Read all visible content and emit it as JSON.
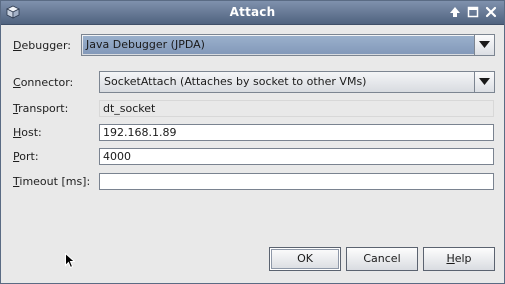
{
  "window": {
    "title": "Attach"
  },
  "form": {
    "debugger": {
      "label": "Debugger:",
      "mnemonic": "D",
      "rest": "ebugger:",
      "value": "Java Debugger (JPDA)"
    },
    "connector": {
      "label": "Connector:",
      "mnemonic": "C",
      "rest": "onnector:",
      "value": "SocketAttach (Attaches by socket to other VMs)"
    },
    "transport": {
      "label": "Transport:",
      "mnemonic": "T",
      "rest": "ransport:",
      "value": "dt_socket"
    },
    "host": {
      "label": "Host:",
      "mnemonic": "H",
      "rest": "ost:",
      "value": "192.168.1.89"
    },
    "port": {
      "label": "Port:",
      "mnemonic": "P",
      "rest": "ort:",
      "value": "4000"
    },
    "timeout": {
      "label": "Timeout [ms]:",
      "mnemonic": "T",
      "rest": "imeout [ms]:",
      "value": ""
    }
  },
  "buttons": {
    "ok": "OK",
    "cancel": "Cancel",
    "help_mnemonic": "H",
    "help_rest": "elp"
  },
  "icons": {
    "app": "cube-icon",
    "titlebar": [
      "maximize-arrow-icon",
      "restore-icon",
      "close-icon"
    ]
  },
  "colors": {
    "titlebar": "#50637f",
    "selection": "#8399ba",
    "dialog_bg": "#e9e9e9"
  }
}
